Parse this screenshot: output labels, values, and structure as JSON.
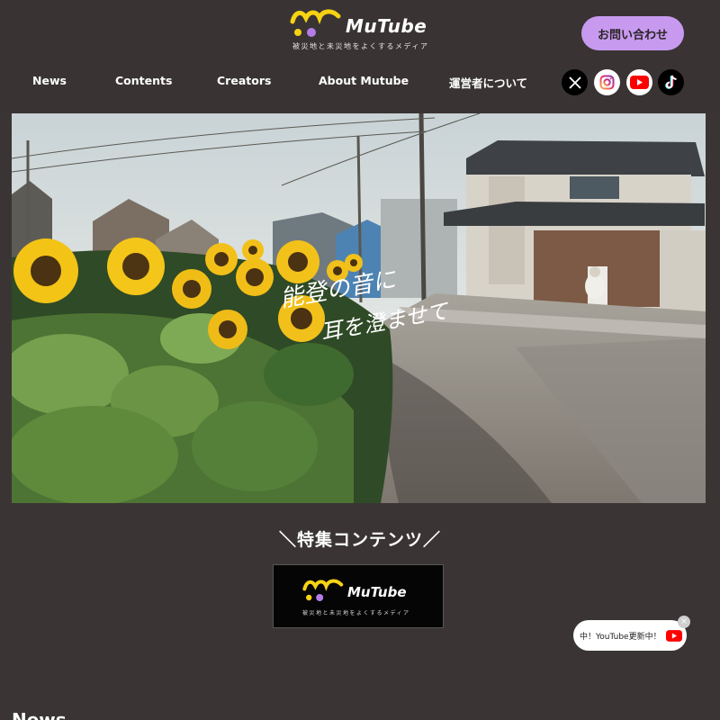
{
  "header": {
    "logo_text": "MuTube",
    "logo_tagline": "被災地と未災地をよくするメディア",
    "contact_label": "お問い合わせ"
  },
  "nav": {
    "items": [
      {
        "label": "News"
      },
      {
        "label": "Contents"
      },
      {
        "label": "Creators"
      },
      {
        "label": "About Mutube"
      },
      {
        "label": "運営者について"
      }
    ]
  },
  "social": [
    {
      "icon": "x-icon",
      "bg": "#000000"
    },
    {
      "icon": "instagram-icon",
      "bg": "#ffffff"
    },
    {
      "icon": "youtube-icon",
      "bg": "#ffffff"
    },
    {
      "icon": "tiktok-icon",
      "bg": "#000000"
    }
  ],
  "hero": {
    "caption_line1": "能登の音に",
    "caption_line2": "耳を澄ませて"
  },
  "featured": {
    "title": "＼特集コンテンツ／",
    "banner_text": "MuTube",
    "banner_tagline": "被災地と未災地をよくするメディア"
  },
  "youtube_popup": {
    "text": "中！YouTube更新中！",
    "close": "×"
  },
  "news": {
    "heading": "News"
  },
  "colors": {
    "background": "#3a3534",
    "accent": "#c79af0",
    "logo_yellow": "#f5d214",
    "logo_purple": "#b57ce8",
    "youtube_red": "#ff0000"
  }
}
